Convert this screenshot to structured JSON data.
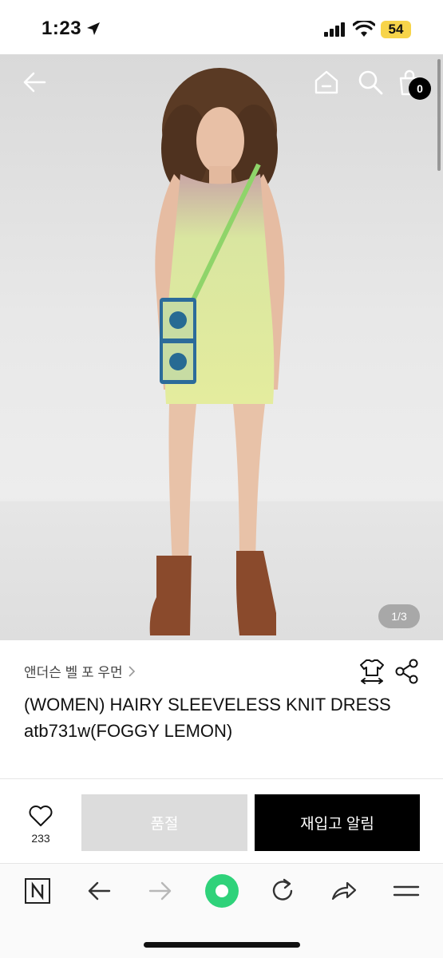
{
  "status_bar": {
    "time": "1:23",
    "battery": "54"
  },
  "hero": {
    "page_indicator": "1/3",
    "cart_count": "0"
  },
  "product": {
    "brand": "앤더슨 벨 포 우먼",
    "title": "(WOMEN) HAIRY SLEEVELESS KNIT DRESS atb731w(FOGGY LEMON)"
  },
  "actions": {
    "like_count": "233",
    "soldout_label": "품절",
    "restock_label": "재입고 알림"
  },
  "icons": {
    "back": "back-arrow-icon",
    "home": "home-icon",
    "search": "search-icon",
    "cart": "cart-icon",
    "size": "size-guide-icon",
    "share": "share-icon",
    "heart": "heart-icon",
    "naver": "naver-n-icon",
    "browser_back": "browser-back-icon",
    "browser_forward": "browser-forward-icon",
    "green_dot": "green-dot-icon",
    "reload": "reload-icon",
    "browser_share": "browser-share-icon",
    "menu": "menu-icon"
  },
  "colors": {
    "restock_button": "#000000",
    "soldout_button": "#dcdcdc",
    "battery": "#f7d44a",
    "green_dot": "#2fd27a"
  }
}
